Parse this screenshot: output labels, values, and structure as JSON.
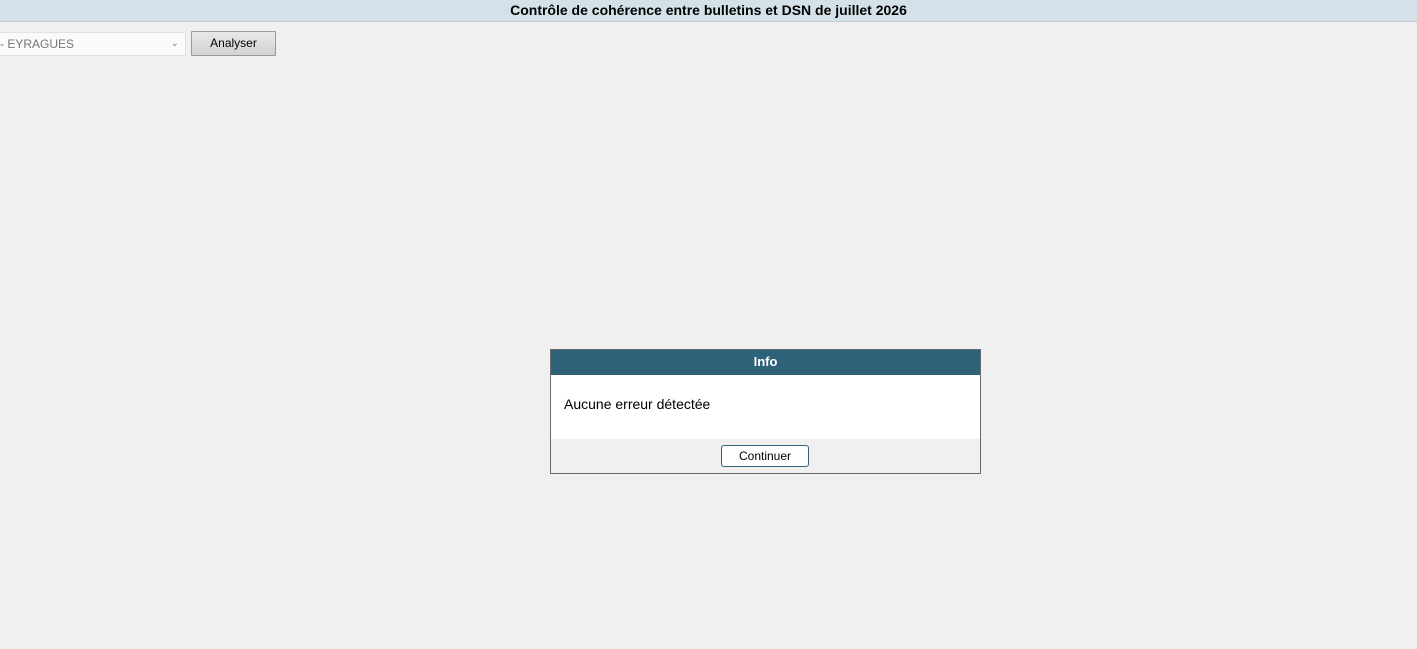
{
  "window": {
    "title": "Contrôle de cohérence entre bulletins et DSN de juillet 2026"
  },
  "toolbar": {
    "site_select": {
      "value": "- EYRAGUES",
      "icon": "chevron-down-icon"
    },
    "analyser_label": "Analyser"
  },
  "dialog": {
    "title": "Info",
    "message": "Aucune erreur détectée",
    "continue_label": "Continuer",
    "header_color": "#2e6279"
  }
}
